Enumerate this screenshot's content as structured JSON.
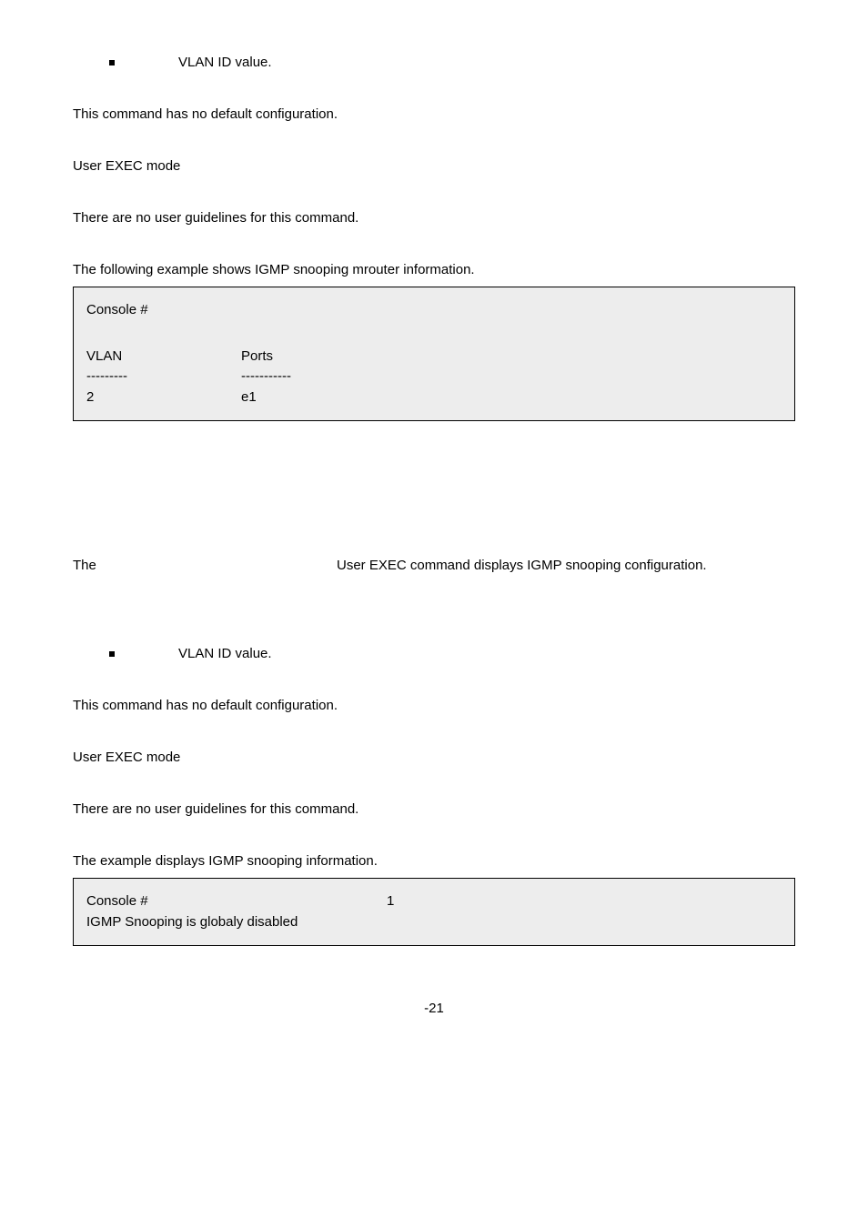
{
  "bullet1": {
    "text": "VLAN ID value."
  },
  "p1": "This command has no default configuration.",
  "p2": "User EXEC mode",
  "p3": "There are no user guidelines for this command.",
  "p4": "The following example shows IGMP snooping mrouter information.",
  "codebox1": {
    "line1": "Console #",
    "hdr_a": "VLAN",
    "hdr_b": "Ports",
    "dash_a": "---------",
    "dash_b": "-----------",
    "val_a": "2",
    "val_b": "e1"
  },
  "sentence": {
    "the": "The",
    "rest": "User EXEC command displays IGMP snooping configuration."
  },
  "bullet2": {
    "text": "VLAN ID value."
  },
  "p5": "This command has no default configuration.",
  "p6": "User EXEC mode",
  "p7": "There are no user guidelines for this command.",
  "p8": "The example displays IGMP snooping information.",
  "codebox2": {
    "line1_a": "Console #",
    "line1_b": "1",
    "line2": "IGMP Snooping is globaly disabled"
  },
  "pagenum": "-21"
}
